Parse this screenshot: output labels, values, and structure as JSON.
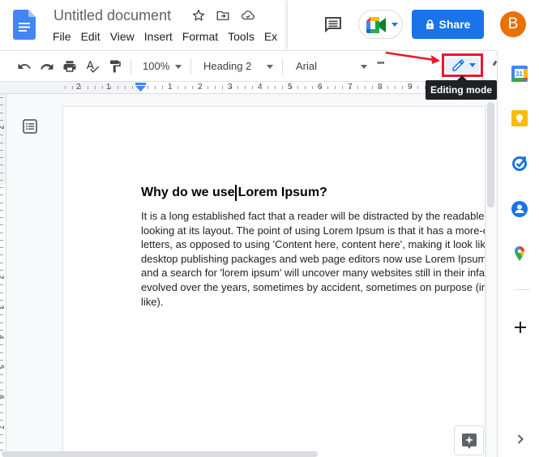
{
  "header": {
    "title": "Untitled document",
    "title_icons": [
      "star-icon",
      "move-to-folder-icon",
      "cloud-saved-icon"
    ],
    "menu": [
      "File",
      "Edit",
      "View",
      "Insert",
      "Format",
      "Tools",
      "Ex"
    ],
    "share_label": "Share",
    "avatar_initial": "B",
    "colors": {
      "share": "#1a73e8",
      "avatar": "#e8710a"
    }
  },
  "toolbar": {
    "zoom": "100%",
    "style": "Heading 2",
    "font": "Arial",
    "more": "•••",
    "editing_mode_tooltip": "Editing mode",
    "highlight_color": "#e8192c"
  },
  "ruler": {
    "labels": [
      "2",
      "1",
      "1",
      "2",
      "3",
      "4",
      "5",
      "6",
      "7",
      "8",
      "9"
    ],
    "vertical_labels": [
      "2",
      "1",
      "1",
      "2",
      "3",
      "4",
      "5",
      "6",
      "7",
      "8"
    ]
  },
  "document": {
    "heading_before_cursor": "Why do we use",
    "heading_after_cursor": "Lorem Ipsum?",
    "body_lines": [
      "It is a long established fact that a reader will be distracted by the readable content of a page when",
      "looking at its layout. The point of using Lorem Ipsum is that it has a more-or-less normal distribution of",
      "letters, as opposed to using 'Content here, content here', making it look like readable English. Many",
      "desktop publishing packages and web page editors now use Lorem Ipsum as their default model text,",
      "and a search for 'lorem ipsum' will uncover many websites still in their infancy. Various versions have",
      "evolved over the years, sometimes by accident, sometimes on purpose (injected humour and the",
      "like)."
    ]
  },
  "side_panel": {
    "calendar_day": "31",
    "apps": [
      "calendar",
      "keep",
      "tasks",
      "contacts",
      "maps"
    ]
  }
}
